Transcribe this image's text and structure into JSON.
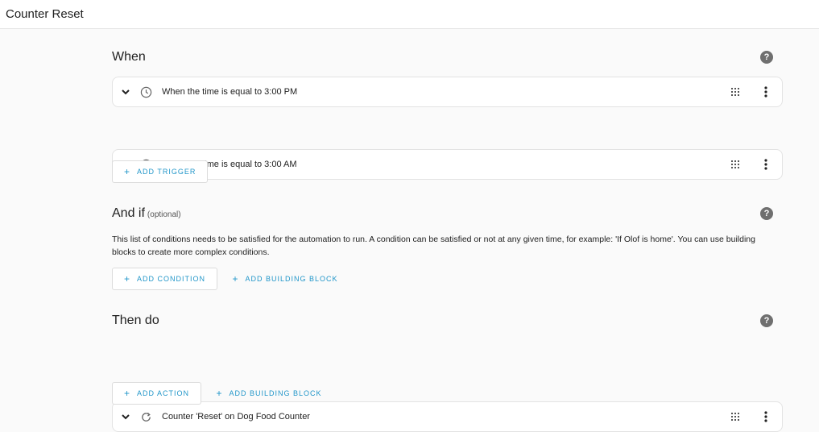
{
  "header": {
    "title": "Counter Reset"
  },
  "when": {
    "heading": "When",
    "triggers": [
      {
        "label": "When the time is equal to 3:00 PM",
        "icon": "clock-icon"
      },
      {
        "label": "When the time is equal to 3:00 AM",
        "icon": "clock-icon"
      }
    ],
    "add_button": "ADD TRIGGER"
  },
  "and_if": {
    "heading": "And if",
    "optional": "(optional)",
    "description": "This list of conditions needs to be satisfied for the automation to run. A condition can be satisfied or not at any given time, for example: 'If Olof is home'. You can use building blocks to create more complex conditions.",
    "add_button": "ADD CONDITION",
    "building_block_button": "ADD BUILDING BLOCK"
  },
  "then_do": {
    "heading": "Then do",
    "actions": [
      {
        "label": "Counter 'Reset' on Dog Food Counter",
        "icon": "refresh-icon"
      }
    ],
    "add_button": "ADD ACTION",
    "building_block_button": "ADD BUILDING BLOCK"
  },
  "help_glyph": "?",
  "plus_glyph": "+",
  "colors": {
    "accent": "#2196c9",
    "help_bg": "#6f6f6f",
    "background": "#fafafa"
  }
}
